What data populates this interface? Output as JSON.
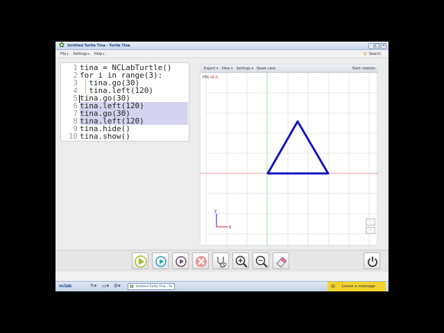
{
  "window": {
    "title": "Untitled Turtle Tina - Turtle Tina"
  },
  "menubar": {
    "items": [
      "File",
      "Settings",
      "Help"
    ],
    "search_label": "Search"
  },
  "editor": {
    "lines": [
      {
        "n": "1",
        "text": "tina = NCLabTurtle()"
      },
      {
        "n": "2",
        "text": "for i in range(3):"
      },
      {
        "n": "3",
        "text": "  tina.go(30)"
      },
      {
        "n": "4",
        "text": "  tina.left(120)"
      },
      {
        "n": "5",
        "text": "tina.go(30)"
      },
      {
        "n": "6",
        "text": "tina.left(120)",
        "selected": true
      },
      {
        "n": "7",
        "text": "tina.go(30)",
        "selected": true
      },
      {
        "n": "8",
        "text": "tina.left(120)",
        "selected": true
      },
      {
        "n": "9",
        "text": "tina.hide()"
      },
      {
        "n": "10",
        "text": "tina.show()"
      }
    ]
  },
  "canvas": {
    "toolbar": [
      "Export",
      "View",
      "Settings",
      "Reset view"
    ],
    "start_rotation": "Start rotation",
    "fps_label": "FPS",
    "fps_value": "60.0",
    "axis_x_label": "x",
    "axis_y_label": "y",
    "colors": {
      "grid": "#d6d6d6",
      "x_axis": "#e07a7a",
      "y_axis": "#7fd97f",
      "shape": "#1010c0"
    }
  },
  "actions": [
    "run-icon",
    "step-icon",
    "play-icon",
    "stop-icon",
    "stethoscope-icon",
    "zoom-in-icon",
    "zoom-out-icon",
    "eraser-icon",
    "power-icon"
  ],
  "taskbar": {
    "logo": "nclab",
    "task_label": "Untitled Turtle Tina - Tu",
    "leave_message": "Leave a message"
  }
}
